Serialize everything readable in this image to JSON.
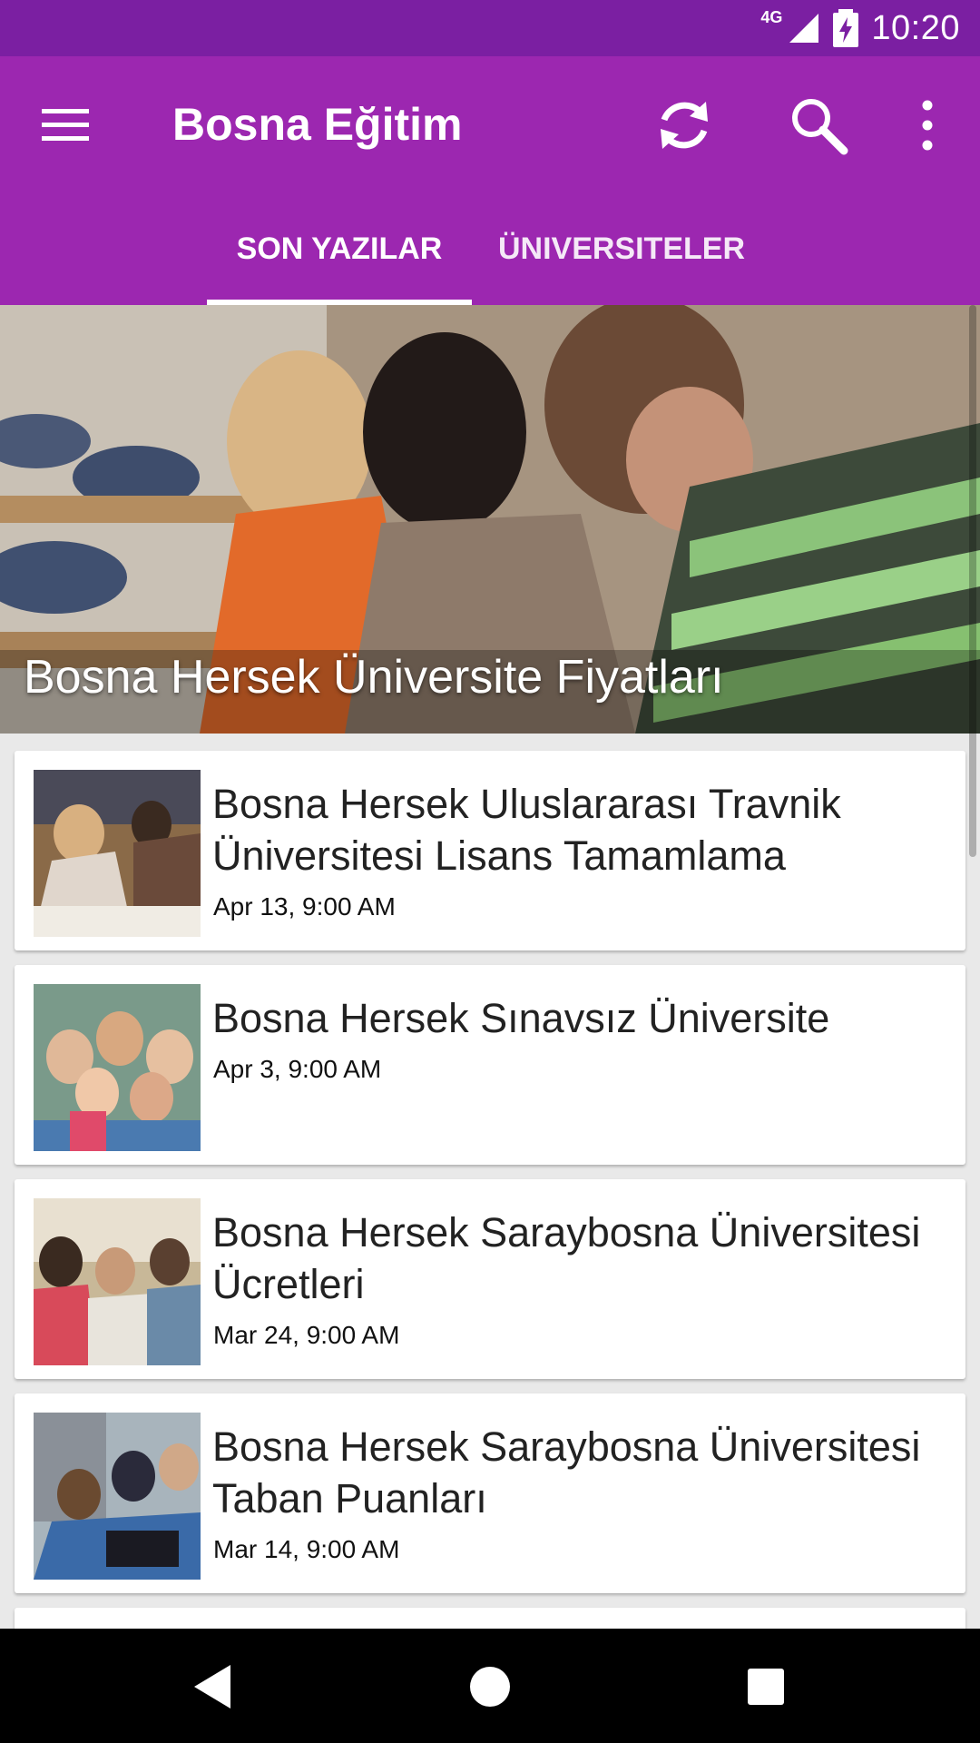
{
  "status_bar": {
    "network": "4G",
    "time": "10:20"
  },
  "app_bar": {
    "title": "Bosna Eğitim",
    "bg": "#9c27b0",
    "status_bg": "#7b1fa2"
  },
  "tabs": [
    {
      "label": "SON YAZILAR",
      "selected": true
    },
    {
      "label": "ÜNIVERSITELER",
      "selected": false
    }
  ],
  "hero": {
    "title": "Bosna Hersek Üniversite Fiyatları",
    "image_icon": "students-writing-photo"
  },
  "posts": [
    {
      "title": "Bosna Hersek Uluslararası Travnik Üniversitesi Lisans Tamamlama",
      "date": "Apr 13, 9:00 AM"
    },
    {
      "title": "Bosna Hersek Sınavsız Üniversite",
      "date": "Apr 3, 9:00 AM"
    },
    {
      "title": "Bosna Hersek Saraybosna Üniversitesi Ücretleri",
      "date": "Mar 24, 9:00 AM"
    },
    {
      "title": "Bosna Hersek Saraybosna Üniversitesi Taban Puanları",
      "date": "Mar 14, 9:00 AM"
    }
  ],
  "icons": [
    "menu-icon",
    "refresh-icon",
    "search-icon",
    "more-vert-icon",
    "back-icon",
    "home-icon",
    "recents-icon"
  ]
}
